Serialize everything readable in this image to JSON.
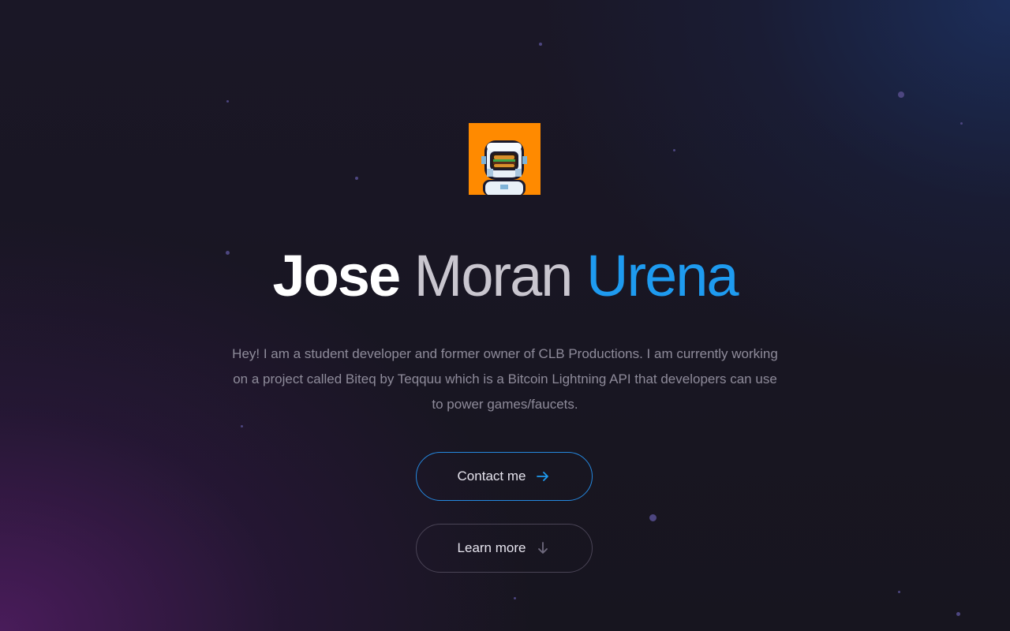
{
  "hero": {
    "name_first": "Jose",
    "name_middle": "Moran",
    "name_last": "Urena",
    "description": "Hey! I am a student developer and former owner of CLB Productions. I am currently working on a project called Biteq by Teqquu which is a Bitcoin Lightning API that developers can use to power games/faucets.",
    "avatar_alt": "pixel astronaut avatar with burger visor"
  },
  "buttons": {
    "contact_label": "Contact me",
    "contact_icon": "arrow-right-icon",
    "learn_label": "Learn more",
    "learn_icon": "arrow-down-icon"
  },
  "colors": {
    "accent": "#1e9bf0",
    "avatar_bg": "#ff8a00",
    "contact_border": "#2589e0",
    "learn_border": "#4a4456",
    "description_text": "#8e8b9a"
  }
}
